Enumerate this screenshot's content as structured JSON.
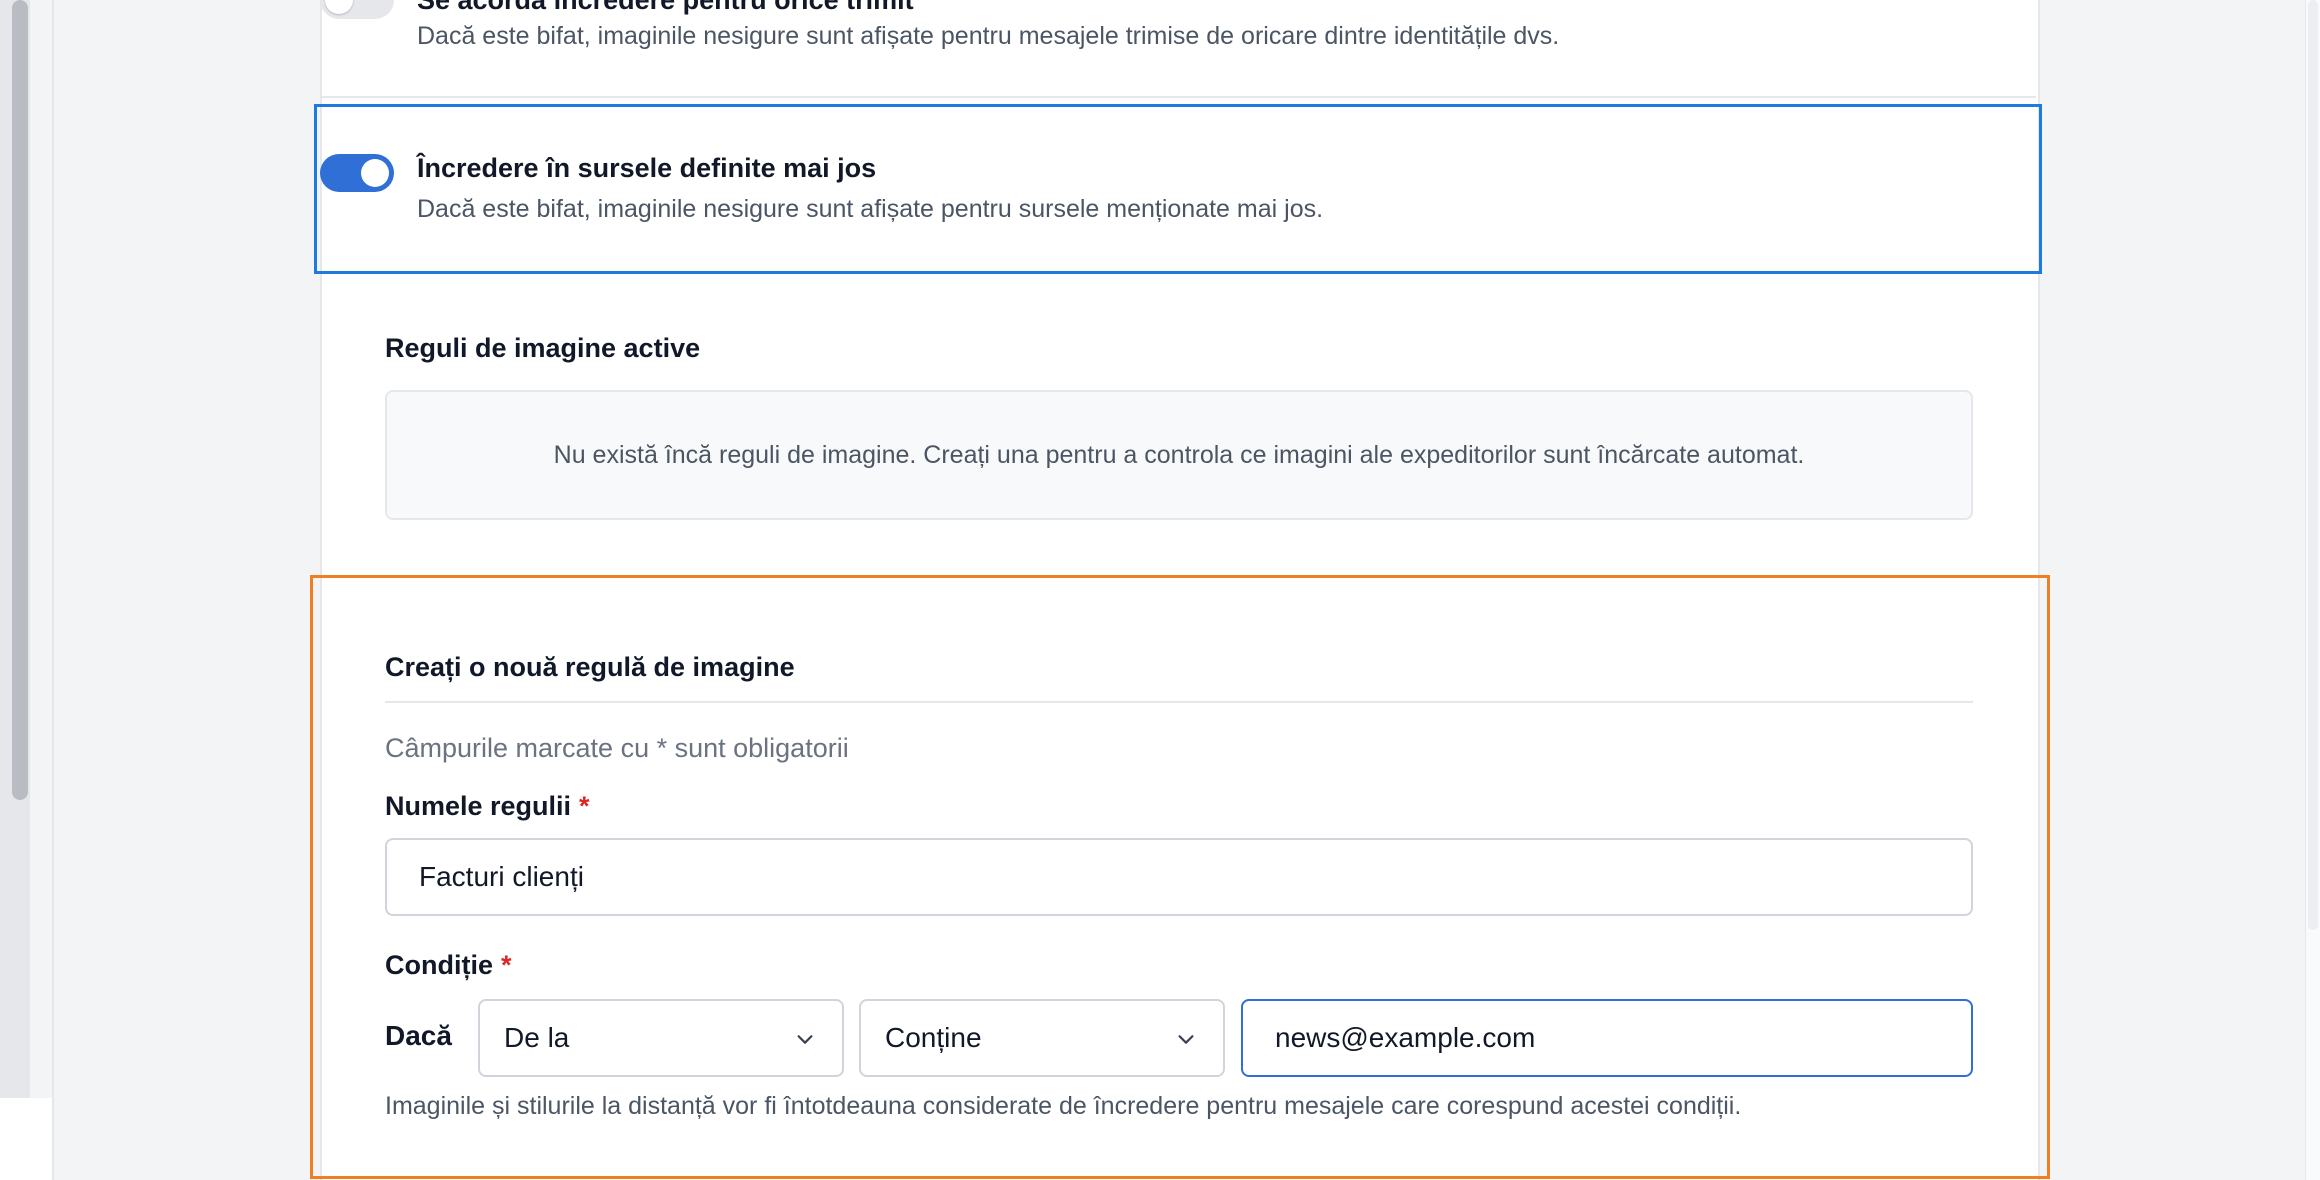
{
  "settings": {
    "trust_any_sender": {
      "title": "Se acordă încredere pentru orice trimit",
      "description": "Dacă este bifat, imaginile nesigure sunt afișate pentru mesajele trimise de oricare dintre identitățile dvs."
    },
    "trust_sources": {
      "title": "Încredere în sursele definite mai jos",
      "description": "Dacă este bifat, imaginile nesigure sunt afișate pentru sursele menționate mai jos."
    }
  },
  "active_rules": {
    "heading": "Reguli de imagine active",
    "empty_message": "Nu există încă reguli de imagine. Creați una pentru a controla ce imagini ale expeditorilor sunt încărcate automat."
  },
  "new_rule_form": {
    "heading": "Creați o nouă regulă de imagine",
    "required_note": "Câmpurile marcate cu * sunt obligatorii",
    "rule_name_label": "Numele regulii",
    "required_star": "*",
    "rule_name_value": "Facturi clienți",
    "condition_label": "Condiție",
    "if_label": "Dacă",
    "field_select": "De la",
    "operator_select": "Conține",
    "condition_value": "news@example.com",
    "hint": "Imaginile și stilurile la distanță vor fi întotdeauna considerate de încredere pentru mesajele care corespund acestei condiții."
  },
  "icons": {
    "select_arrow": "chevron-down-icon"
  },
  "colors": {
    "accent": "#2f6fd6",
    "highlight_blue": "#1f7ae0",
    "highlight_orange": "#f07f22",
    "required": "#dc2626"
  }
}
